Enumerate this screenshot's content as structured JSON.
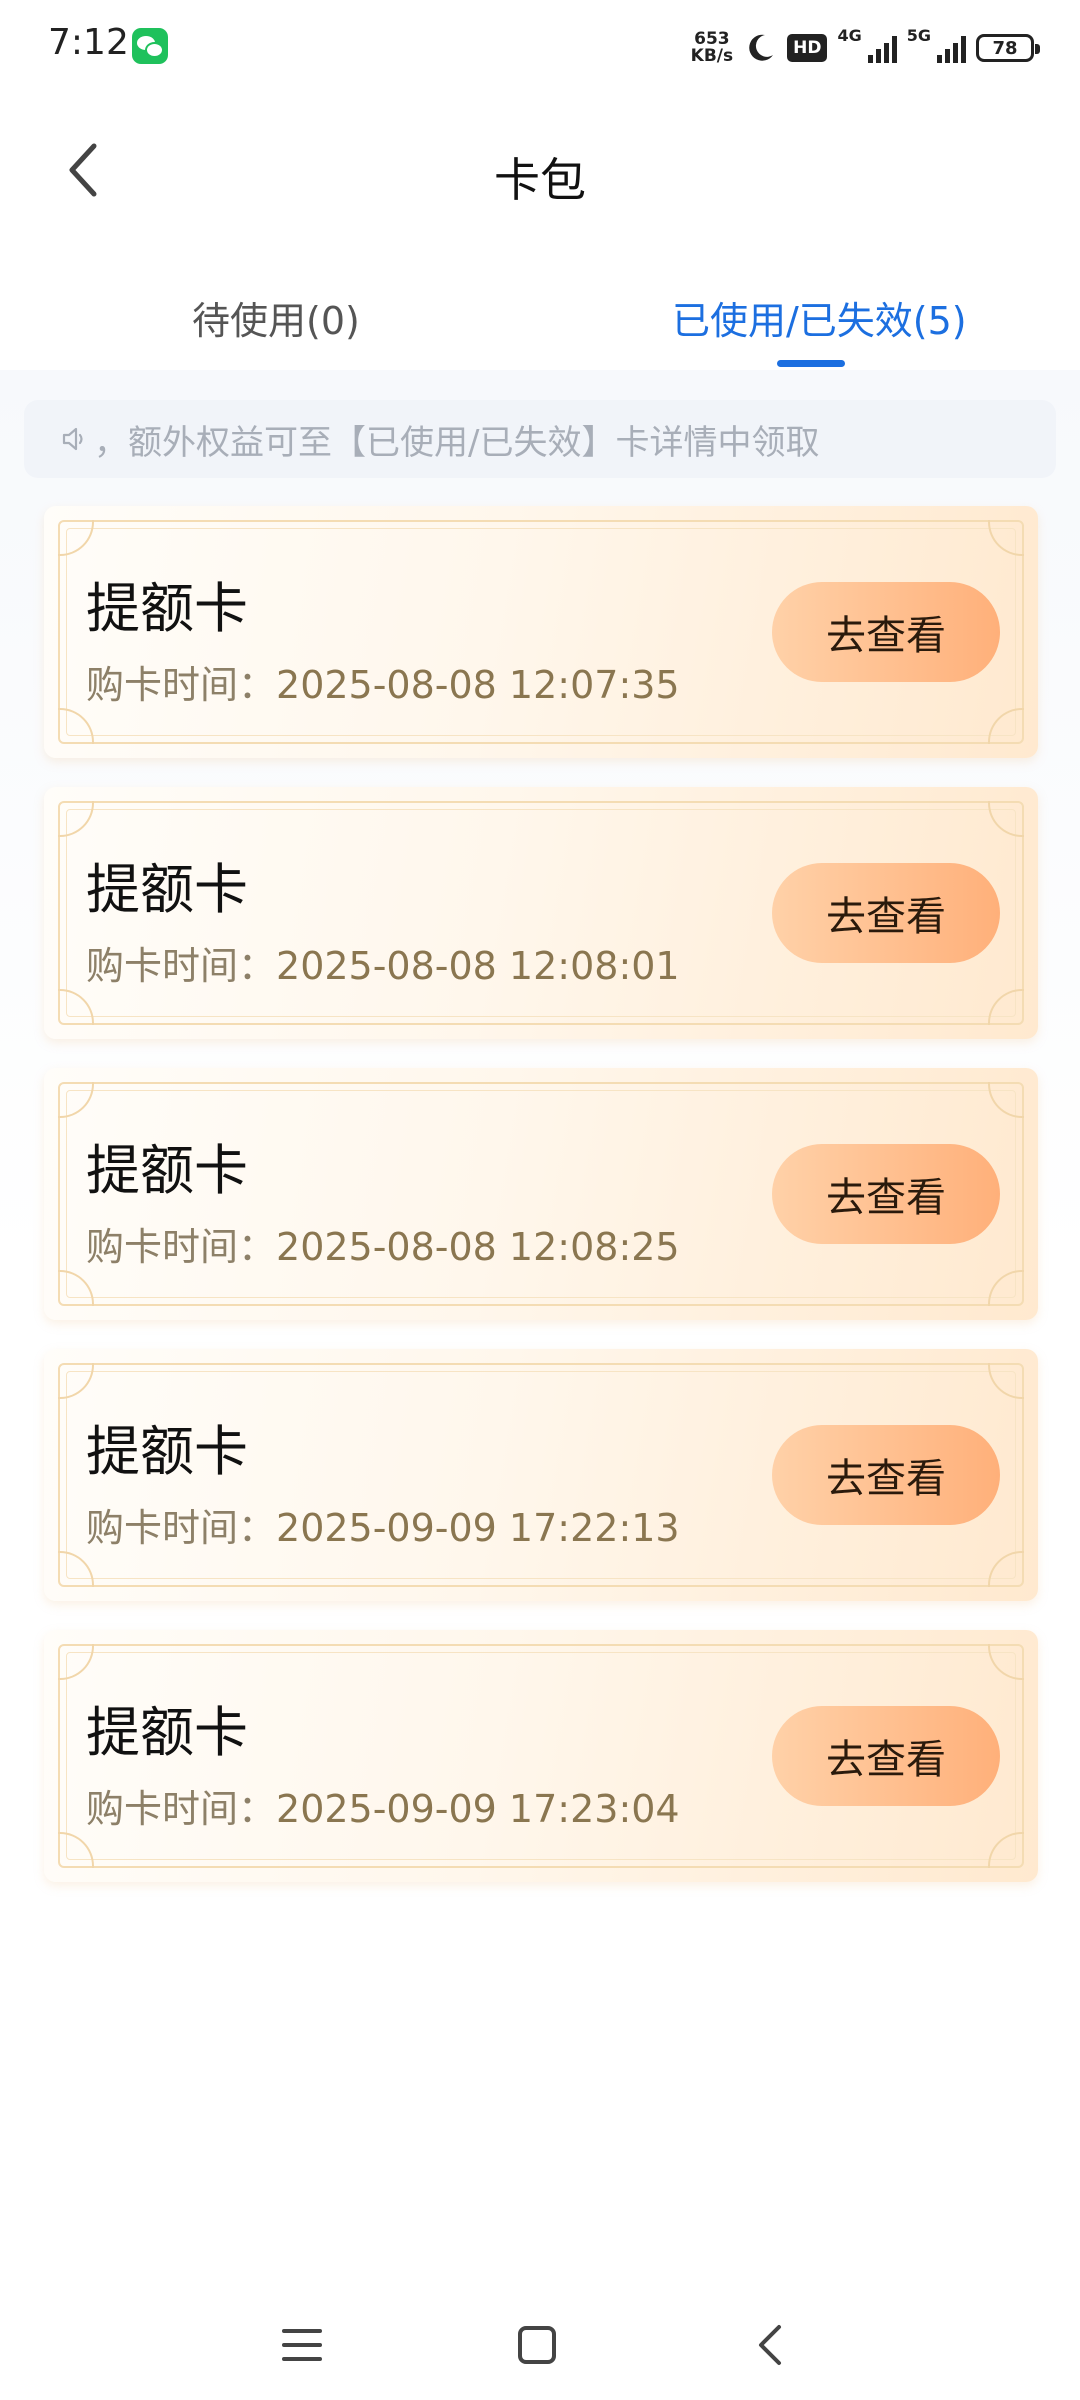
{
  "status_bar": {
    "time": "7:12",
    "net_speed_value": "653",
    "net_speed_unit": "KB/s",
    "hd_label": "HD",
    "net_1": "4G",
    "net_2": "5G",
    "battery": "78"
  },
  "header": {
    "title": "卡包"
  },
  "tabs": [
    {
      "label": "待使用(0)",
      "active": false
    },
    {
      "label": "已使用/已失效(5)",
      "active": true
    }
  ],
  "notice": {
    "text": "，额外权益可至【已使用/已失效】卡详情中领取"
  },
  "cards": [
    {
      "title": "提额卡",
      "time_label": "购卡时间：",
      "time": "2025-08-08 12:07:35",
      "button": "去查看"
    },
    {
      "title": "提额卡",
      "time_label": "购卡时间：",
      "time": "2025-08-08 12:08:01",
      "button": "去查看"
    },
    {
      "title": "提额卡",
      "time_label": "购卡时间：",
      "time": "2025-08-08 12:08:25",
      "button": "去查看"
    },
    {
      "title": "提额卡",
      "time_label": "购卡时间：",
      "time": "2025-09-09 17:22:13",
      "button": "去查看"
    },
    {
      "title": "提额卡",
      "time_label": "购卡时间：",
      "time": "2025-09-09 17:23:04",
      "button": "去查看"
    }
  ],
  "colors": {
    "accent": "#1c6fe0",
    "card_button": "#ffb07a",
    "time_text": "#8a7650"
  }
}
